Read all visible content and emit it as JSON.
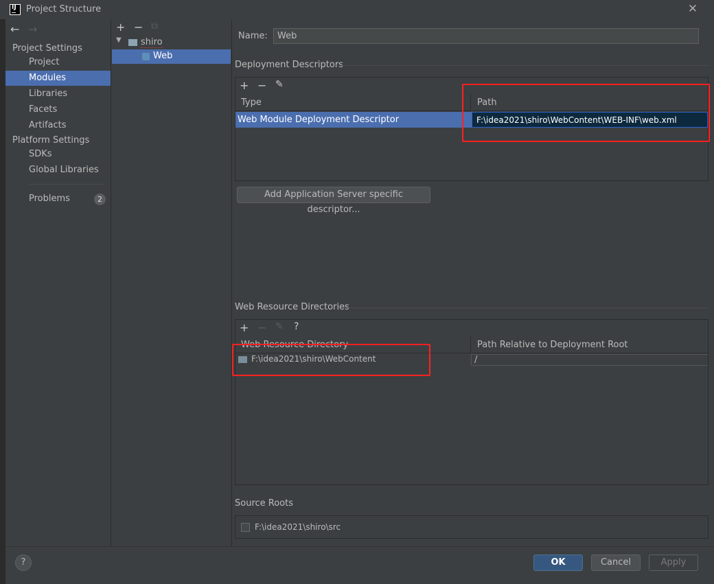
{
  "window": {
    "title": "Project Structure",
    "close_glyph": "✕"
  },
  "nav": {
    "back": "←",
    "forward": "→"
  },
  "sidebar": {
    "project_settings": "Project Settings",
    "items_project": [
      "Project",
      "Modules",
      "Libraries",
      "Facets",
      "Artifacts"
    ],
    "platform_settings": "Platform Settings",
    "items_platform": [
      "SDKs",
      "Global Libraries"
    ],
    "problems": "Problems",
    "problems_count": "2",
    "selected": "Modules"
  },
  "tree": {
    "toolbar": {
      "add": "+",
      "remove": "−",
      "copy": "⧉"
    },
    "root": "shiro",
    "child": "Web"
  },
  "main": {
    "name_label": "Name:",
    "name_value": "Web",
    "deployment": {
      "title": "Deployment Descriptors",
      "toolbar": {
        "add": "+",
        "remove": "−",
        "edit": "✎"
      },
      "col_type": "Type",
      "col_path": "Path",
      "row_type": "Web Module Deployment Descriptor",
      "row_path": "F:\\idea2021\\shiro\\WebContent\\WEB-INF\\web.xml",
      "add_button": "Add Application Server specific descriptor..."
    },
    "web_resources": {
      "title": "Web Resource Directories",
      "toolbar": {
        "add": "+",
        "remove": "−",
        "edit": "✎",
        "help": "?"
      },
      "col_dir": "Web Resource Directory",
      "col_rel": "Path Relative to Deployment Root",
      "row_dir": "F:\\idea2021\\shiro\\WebContent",
      "row_rel": "/"
    },
    "source_roots": {
      "title": "Source Roots",
      "row": "F:\\idea2021\\shiro\\src"
    }
  },
  "footer": {
    "help": "?",
    "ok": "OK",
    "cancel": "Cancel",
    "apply": "Apply"
  },
  "colors": {
    "selection": "#4b6eaf",
    "annotation": "#ff2020",
    "ok_button": "#365880"
  }
}
